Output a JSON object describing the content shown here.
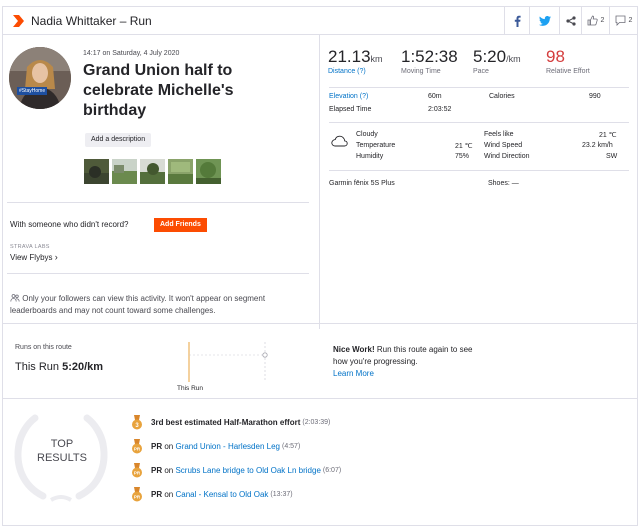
{
  "header": {
    "title": "Nadia Whittaker – Run",
    "kudos_count": "2",
    "comments_count": "2"
  },
  "activity": {
    "datetime": "14:17 on Saturday, 4 July 2020",
    "title": "Grand Union half to celebrate Michelle's birthday",
    "add_description": "Add a description",
    "avatar_tag": "#StayHome"
  },
  "social": {
    "with_someone": "With someone who didn't record?",
    "add_friends": "Add Friends",
    "labs": "STRAVA LABS",
    "view_flybys": "View Flybys",
    "privacy_notice": "Only your followers can view this activity. It won't appear on segment leaderboards and may not count toward some challenges."
  },
  "stats": {
    "distance": {
      "value": "21.13",
      "unit": "km",
      "label": "Distance (?)"
    },
    "moving_time": {
      "value": "1:52:38",
      "label": "Moving Time"
    },
    "pace": {
      "value": "5:20",
      "unit": "/km",
      "label": "Pace"
    },
    "relative_effort": {
      "value": "98",
      "label": "Relative Effort"
    },
    "elevation_label": "Elevation (?)",
    "elevation_value": "60m",
    "calories_label": "Calories",
    "calories_value": "990",
    "elapsed_label": "Elapsed Time",
    "elapsed_value": "2:03:52"
  },
  "weather": {
    "condition": "Cloudy",
    "temperature_label": "Temperature",
    "temperature_value": "21 ℃",
    "humidity_label": "Humidity",
    "humidity_value": "75%",
    "feels_like_label": "Feels like",
    "feels_like_value": "21 ℃",
    "wind_speed_label": "Wind Speed",
    "wind_speed_value": "23.2 km/h",
    "wind_direction_label": "Wind Direction",
    "wind_direction_value": "SW"
  },
  "gear": {
    "device": "Garmin fēnix 5S Plus",
    "shoes": "Shoes: —"
  },
  "route": {
    "label": "Runs on this route",
    "this_run_prefix": "This Run",
    "this_run_pace": "5:20/km",
    "chart_label": "This Run",
    "nice_bold": "Nice Work!",
    "nice_text": " Run this route again to see how you're progressing.",
    "learn_more": "Learn More"
  },
  "top_results": {
    "title_line1": "TOP",
    "title_line2": "RESULTS",
    "items": [
      {
        "medal": "3",
        "bold": "3rd best estimated Half-Marathon effort",
        "time": "(2:03:39)"
      },
      {
        "medal": "PR",
        "bold": "PR",
        "on": " on ",
        "link": "Grand Union - Harlesden Leg",
        "time": "(4:57)"
      },
      {
        "medal": "PR",
        "bold": "PR",
        "on": " on ",
        "link": "Scrubs Lane bridge to Old Oak Ln bridge",
        "time": "(6:07)"
      },
      {
        "medal": "PR",
        "bold": "PR",
        "on": " on ",
        "link": "Canal - Kensal to Old Oak",
        "time": "(13:37)"
      }
    ]
  },
  "colors": {
    "strava_orange": "#fc4c02",
    "link_blue": "#0072c7",
    "effort_red": "#d43d3d",
    "medal_gold": "#e8a33d"
  }
}
